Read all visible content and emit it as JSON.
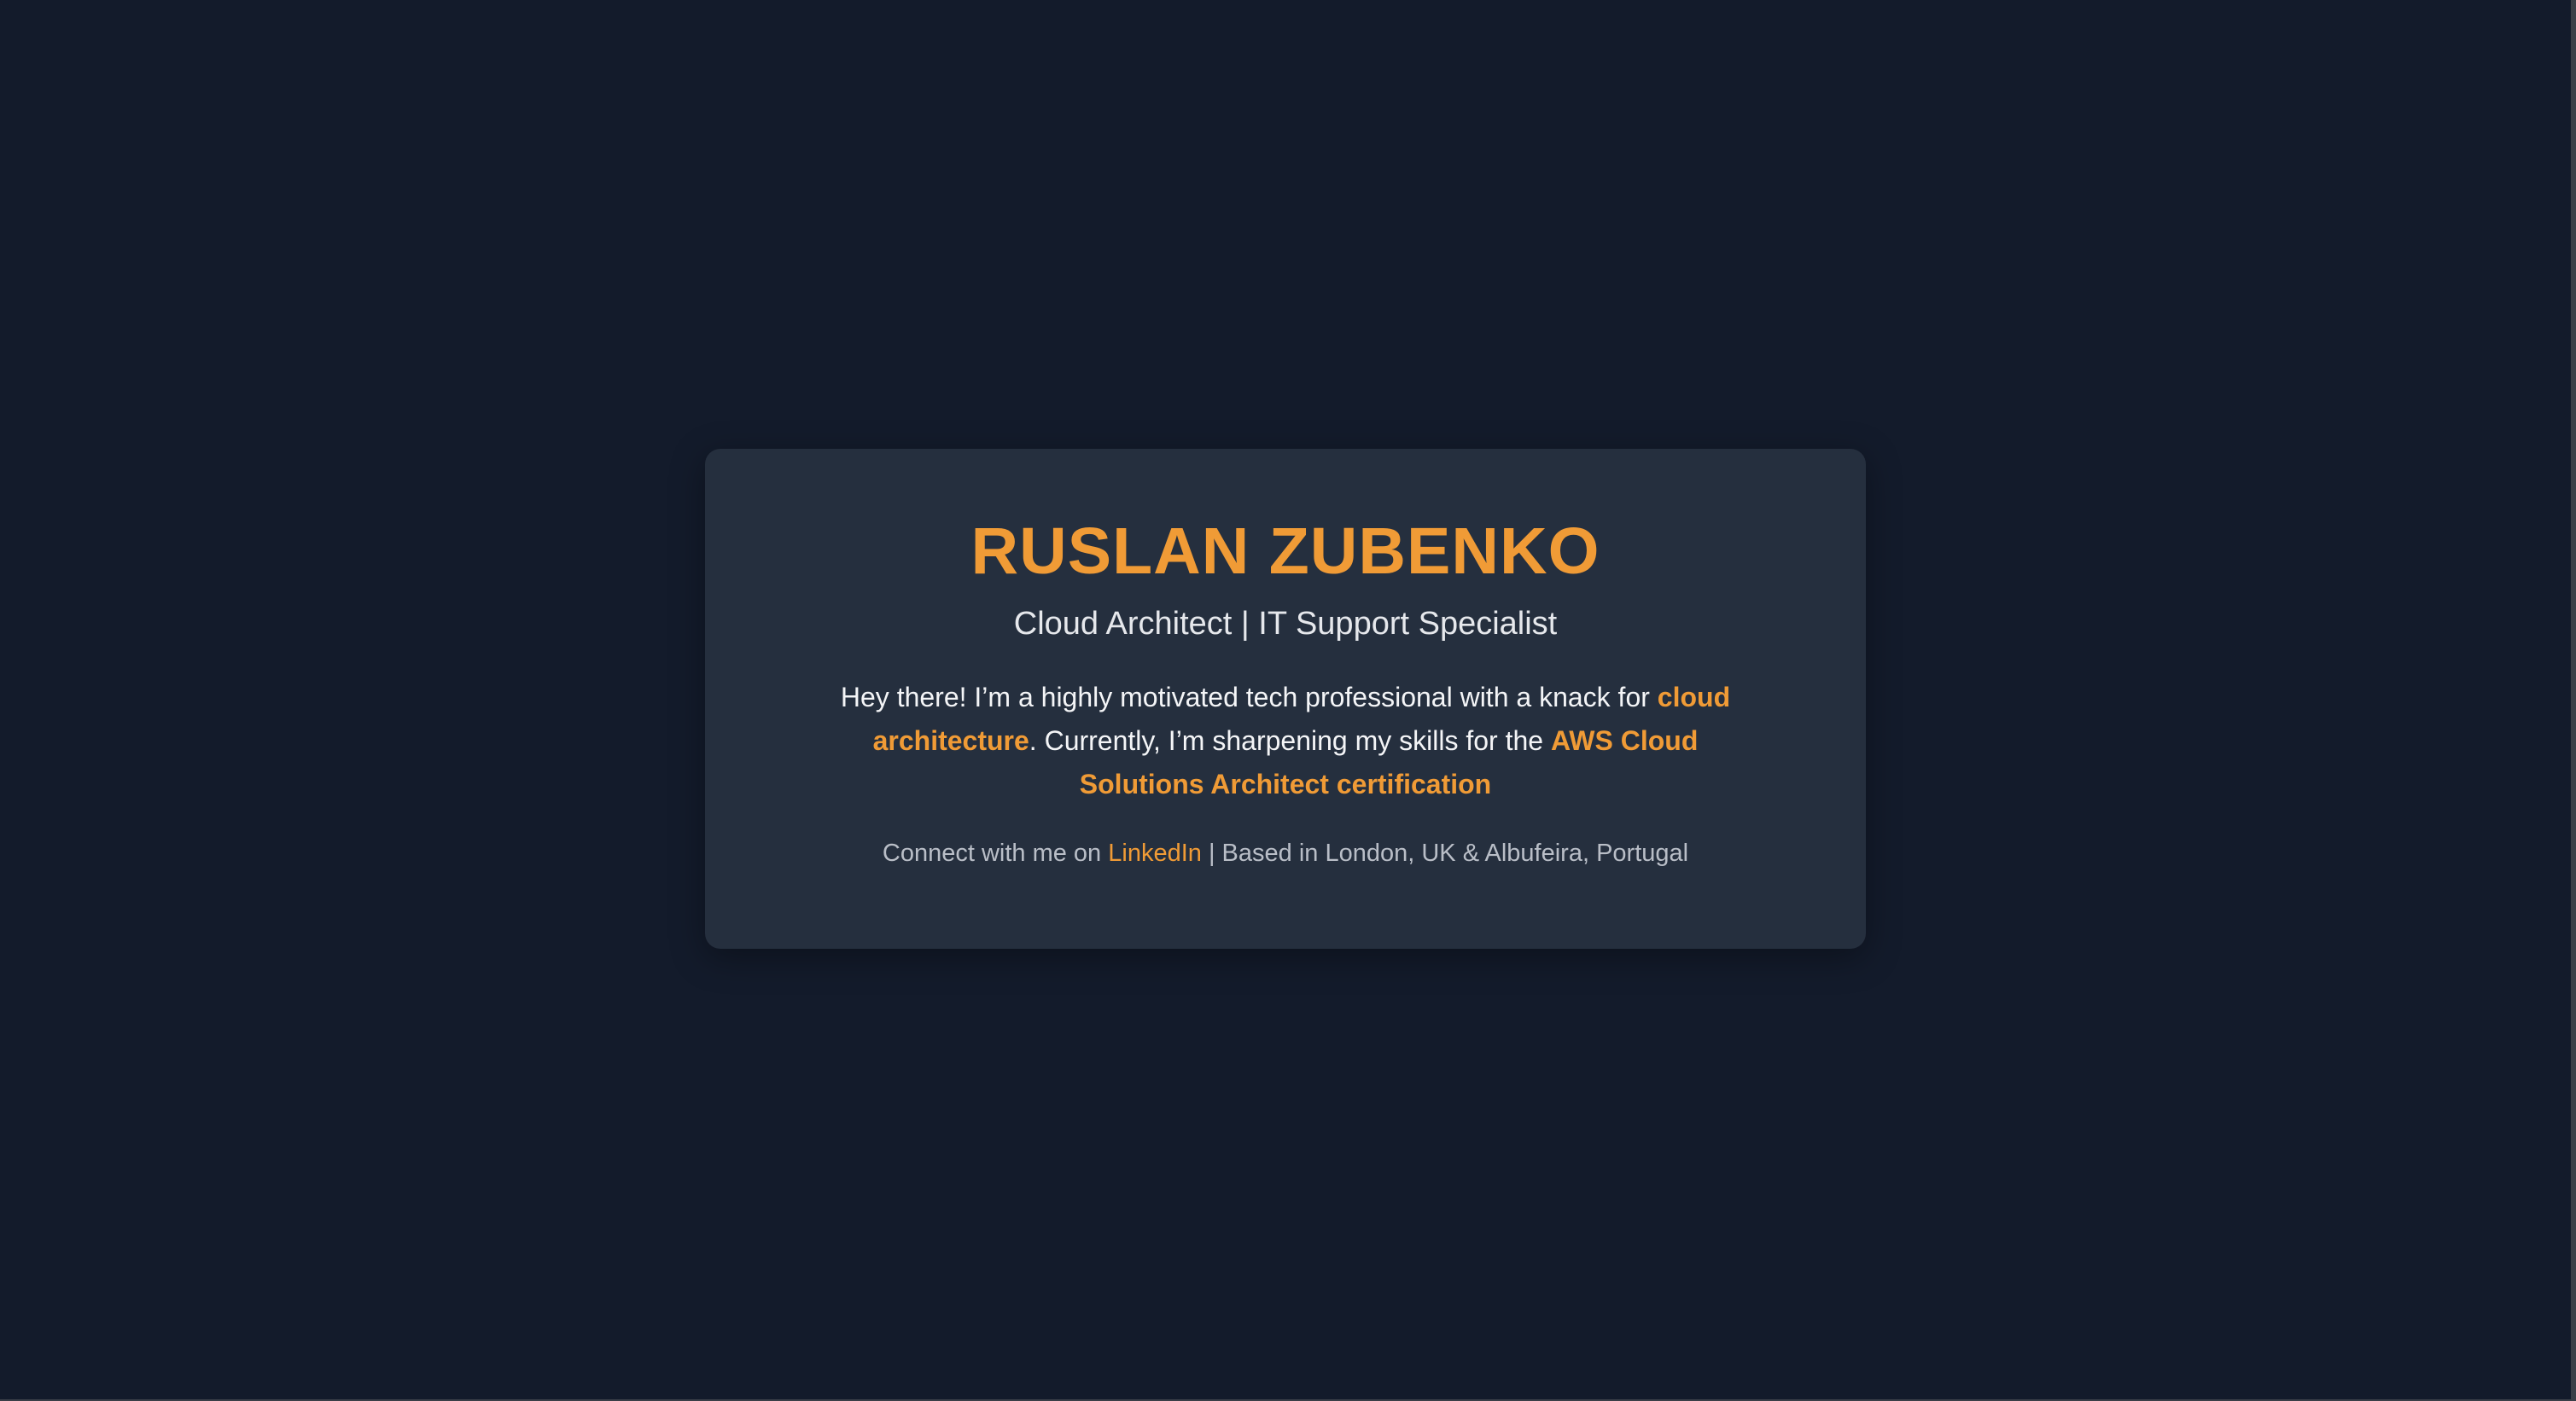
{
  "profile": {
    "name": "RUSLAN ZUBENKO",
    "title": "Cloud Architect | IT Support Specialist"
  },
  "intro": {
    "part1": "Hey there! I’m a highly motivated tech professional with a knack for ",
    "highlight1": "cloud architecture",
    "part2": ". Currently, I’m sharpening my skills for the ",
    "highlight2": "AWS Cloud Solutions Architect certification"
  },
  "footer": {
    "prefix": "Connect with me on ",
    "link_label": "LinkedIn",
    "suffix": " | Based in London, UK & Albufeira, Portugal"
  },
  "colors": {
    "background": "#131b2b",
    "card": "#252f3e",
    "accent": "#f09b36",
    "text": "#f4f5f7",
    "muted": "#b9bec7"
  }
}
